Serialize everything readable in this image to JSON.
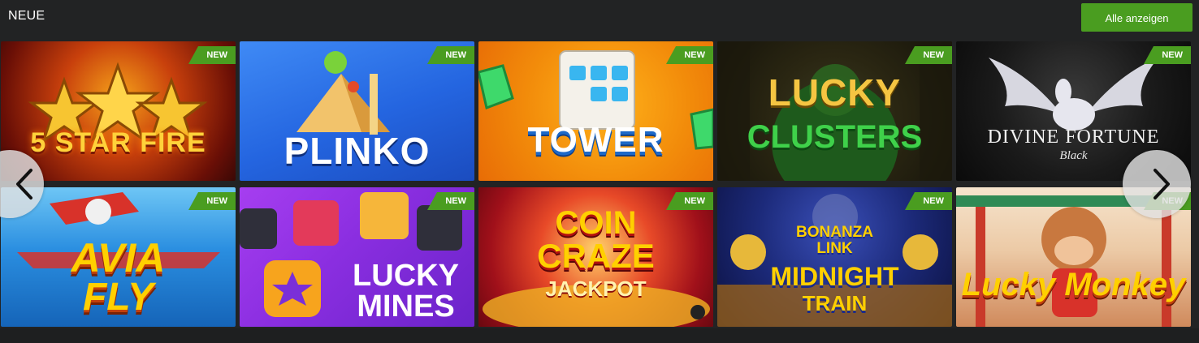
{
  "section": {
    "title": "NEUE",
    "show_all_label": "Alle anzeigen"
  },
  "badge_label": "NEW",
  "games": [
    {
      "title": "5 STAR FIRE",
      "subtitle": ""
    },
    {
      "title": "PLINKO",
      "subtitle": ""
    },
    {
      "title": "TOWER",
      "subtitle": ""
    },
    {
      "title": "LUCKY",
      "subtitle": "CLUSTERS"
    },
    {
      "title": "DIVINE FORTUNE",
      "subtitle": "Black"
    },
    {
      "title": "AVIA",
      "subtitle": "FLY"
    },
    {
      "title": "LUCKY",
      "subtitle": "MINES"
    },
    {
      "title": "COIN",
      "subtitle": "CRAZE",
      "extra": "JACKPOT"
    },
    {
      "title": "BONANZA",
      "subtitle": "LINK",
      "extra": "MIDNIGHT",
      "extra2": "TRAIN"
    },
    {
      "title": "Lucky Monkey",
      "subtitle": ""
    }
  ],
  "nav": {
    "prev_icon": "chevron-left-icon",
    "next_icon": "chevron-right-icon"
  },
  "colors": {
    "accent": "#4a9d20",
    "background": "#222324"
  }
}
